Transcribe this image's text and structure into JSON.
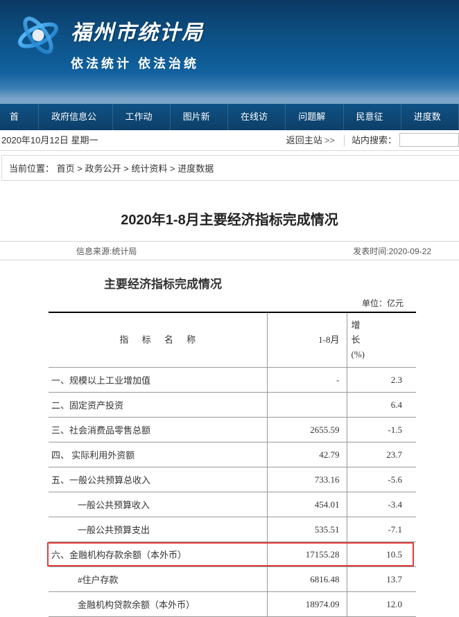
{
  "site": {
    "title": "福州市统计局",
    "slogan": "依法统计 依法治统"
  },
  "nav": {
    "items": [
      "首页",
      "政府信息公开",
      "工作动态",
      "图片新闻",
      "在线访谈",
      "问题解答",
      "民意征集",
      "进度数据"
    ]
  },
  "subnav": {
    "date": "2020年10月12日  星期一",
    "back_label": "返回主站",
    "arrows": ">>",
    "search_label": "站内搜索："
  },
  "breadcrumb": {
    "label": "当前位置：",
    "path": [
      "首页",
      "政务公开",
      "统计资料",
      "进度数据"
    ],
    "separator": " > "
  },
  "article": {
    "title": "2020年1-8月主要经济指标完成情况",
    "source_label": "信息来源:统计局",
    "time_label": "发表时间:2020-09-22"
  },
  "table": {
    "heading": "主要经济指标完成情况",
    "unit": "单位：亿元",
    "head": {
      "indicator": "指 标 名 称",
      "col_a": "1-8月",
      "col_b": "增\n长\n(%)"
    }
  },
  "chart_data": {
    "type": "table",
    "title": "主要经济指标完成情况",
    "unit": "亿元",
    "columns": [
      "指标名称",
      "1-8月",
      "增长(%)"
    ],
    "rows": [
      {
        "name": "一、规模以上工业增加值",
        "value": "-",
        "growth": "2.3",
        "indent": false,
        "highlight": false
      },
      {
        "name": "二、固定资产投资",
        "value": "",
        "growth": "6.4",
        "indent": false,
        "highlight": false
      },
      {
        "name": "三、社会消费品零售总额",
        "value": "2655.59",
        "growth": "-1.5",
        "indent": false,
        "highlight": false
      },
      {
        "name": "四、 实际利用外资额",
        "value": "42.79",
        "growth": "23.7",
        "indent": false,
        "highlight": false
      },
      {
        "name": "五、一般公共预算总收入",
        "value": "733.16",
        "growth": "-5.6",
        "indent": false,
        "highlight": false
      },
      {
        "name": "一般公共预算收入",
        "value": "454.01",
        "growth": "-3.4",
        "indent": true,
        "highlight": false
      },
      {
        "name": "一般公共预算支出",
        "value": "535.51",
        "growth": "-7.1",
        "indent": true,
        "highlight": false
      },
      {
        "name": "六、金融机构存款余额（本外币）",
        "value": "17155.28",
        "growth": "10.5",
        "indent": false,
        "highlight": true
      },
      {
        "name": "#住户存款",
        "value": "6816.48",
        "growth": "13.7",
        "indent": true,
        "highlight": false
      },
      {
        "name": "金融机构贷款余额（本外币）",
        "value": "18974.09",
        "growth": "12.0",
        "indent": true,
        "highlight": false
      }
    ]
  }
}
